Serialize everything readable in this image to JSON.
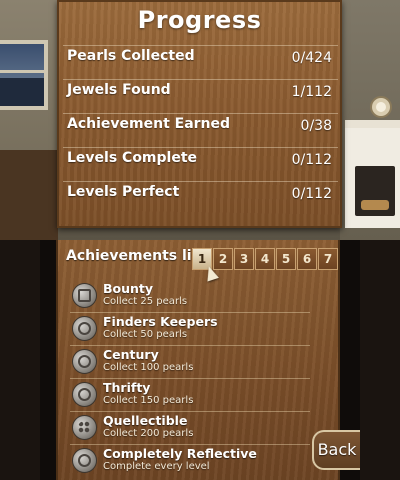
{
  "progress": {
    "title": "Progress",
    "stats": [
      {
        "label": "Pearls Collected",
        "value": "0/424"
      },
      {
        "label": "Jewels Found",
        "value": "1/112"
      },
      {
        "label": "Achievement Earned",
        "value": "0/38"
      },
      {
        "label": "Levels Complete",
        "value": "0/112"
      },
      {
        "label": "Levels Perfect",
        "value": "0/112"
      }
    ]
  },
  "achievements": {
    "header": "Achievements list",
    "pages": [
      "1",
      "2",
      "3",
      "4",
      "5",
      "6",
      "7"
    ],
    "active_page": 1,
    "items": [
      {
        "name": "Bounty",
        "desc": "Collect 25 pearls",
        "icon": "bounty-icon"
      },
      {
        "name": "Finders Keepers",
        "desc": "Collect 50 pearls",
        "icon": "magnifier-icon"
      },
      {
        "name": "Century",
        "desc": "Collect 100 pearls",
        "icon": "pearl-icon"
      },
      {
        "name": "Thrifty",
        "desc": "Collect 150 pearls",
        "icon": "hand-icon"
      },
      {
        "name": "Quellectible",
        "desc": "Collect 200 pearls",
        "icon": "pearl-cluster-icon"
      },
      {
        "name": "Completely Reflective",
        "desc": "Complete every level",
        "icon": "mirror-icon"
      }
    ]
  },
  "back_button": {
    "label": "Back"
  }
}
